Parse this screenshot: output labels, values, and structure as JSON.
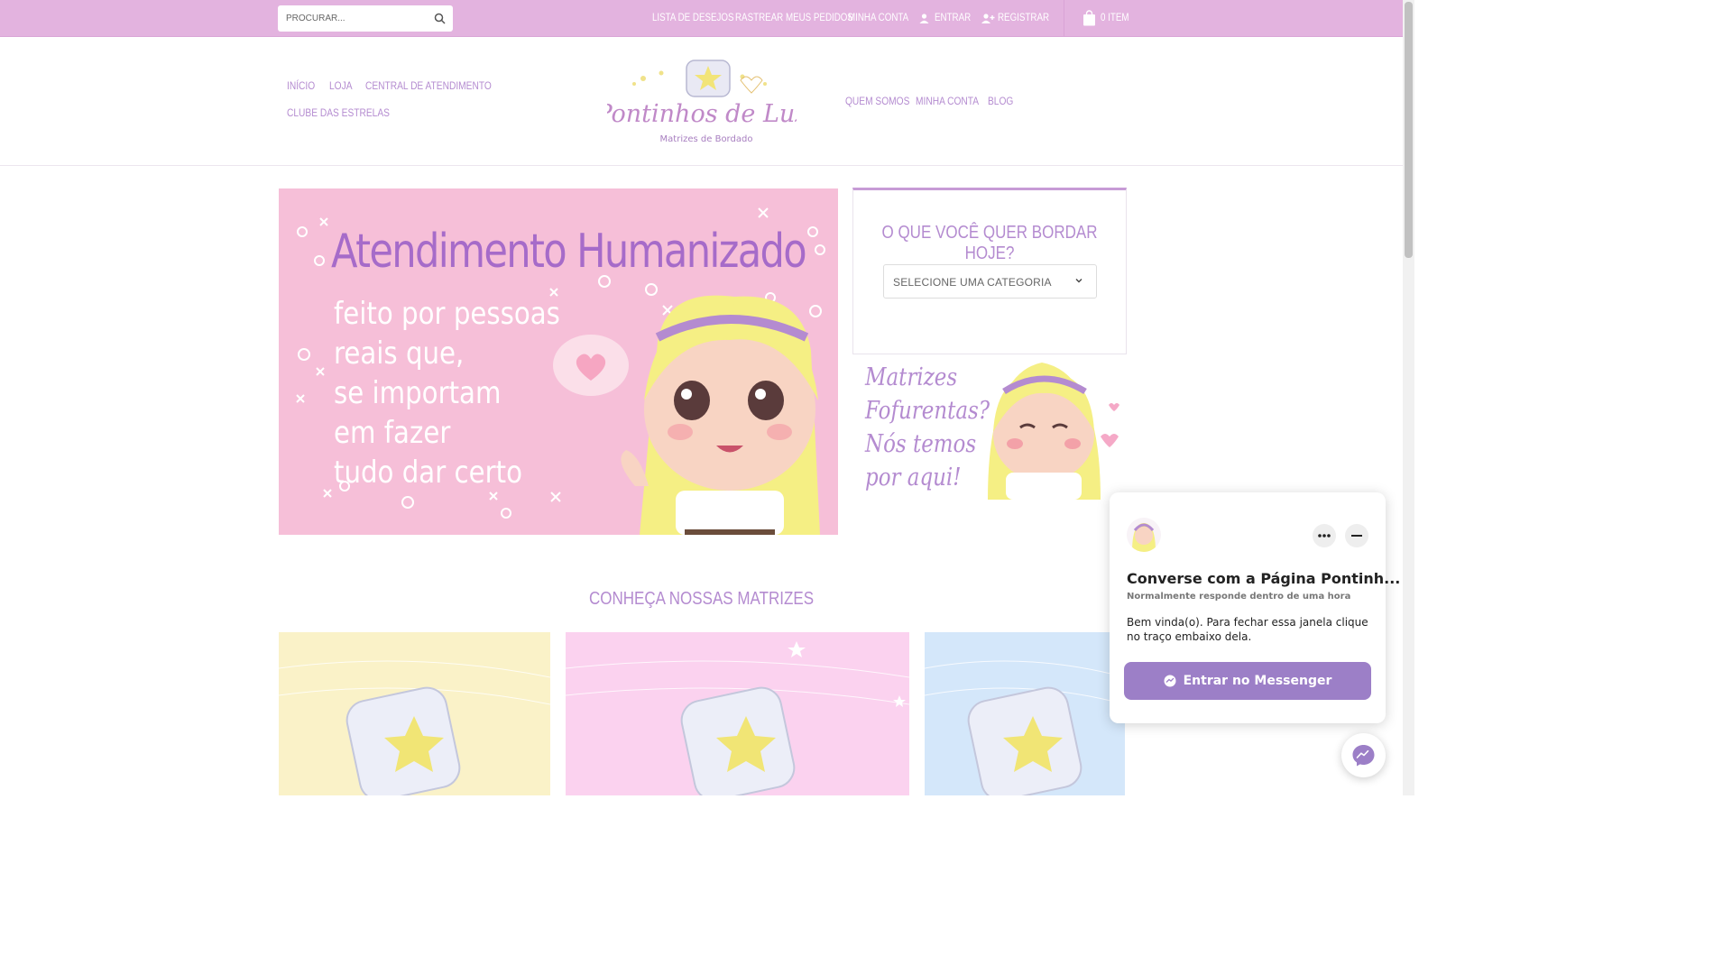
{
  "topbar": {
    "search_placeholder": "PROCURAR...",
    "links": [
      "LISTA DE DESEJOS",
      "RASTREAR MEUS PEDIDOS",
      "MINHA CONTA",
      "ENTRAR",
      "REGISTRAR"
    ],
    "cart": "0 ITEM"
  },
  "nav_left": [
    "INÍCIO",
    "LOJA",
    "CENTRAL DE ATENDIMENTO",
    "CLUBE DAS ESTRELAS"
  ],
  "nav_right": [
    "QUEM SOMOS",
    "MINHA CONTA",
    "BLOG"
  ],
  "logo": {
    "name": "Pontinhos de Luz",
    "tagline": "Matrizes de Bordado"
  },
  "banner": {
    "title": "Atendimento Humanizado",
    "lines": [
      "feito por pessoas",
      "reais que,",
      "se importam",
      "em fazer",
      "tudo dar certo"
    ]
  },
  "sidebar": {
    "widget_title": "O QUE VOCÊ QUER BORDAR HOJE?",
    "select_value": "SELECIONE UMA CATEGORIA",
    "promo_lines": [
      "Matrizes",
      "Fofurentas?",
      "Nós temos",
      "por aqui!"
    ]
  },
  "section_title": "CONHEÇA NOSSAS MATRIZES",
  "messenger": {
    "title": "Converse com a Página Pontinh...",
    "subtitle": "Normalmente responde dentro de uma hora",
    "message": "Bem vinda(o). Para fechar essa janela clique no traço embaixo dela.",
    "button": "Entrar no Messenger"
  },
  "colors": {
    "topbar": "#e3b3df",
    "accent": "#b48bd0",
    "banner": "#f6bfd8",
    "messenger_button": "#9c7fc7"
  }
}
